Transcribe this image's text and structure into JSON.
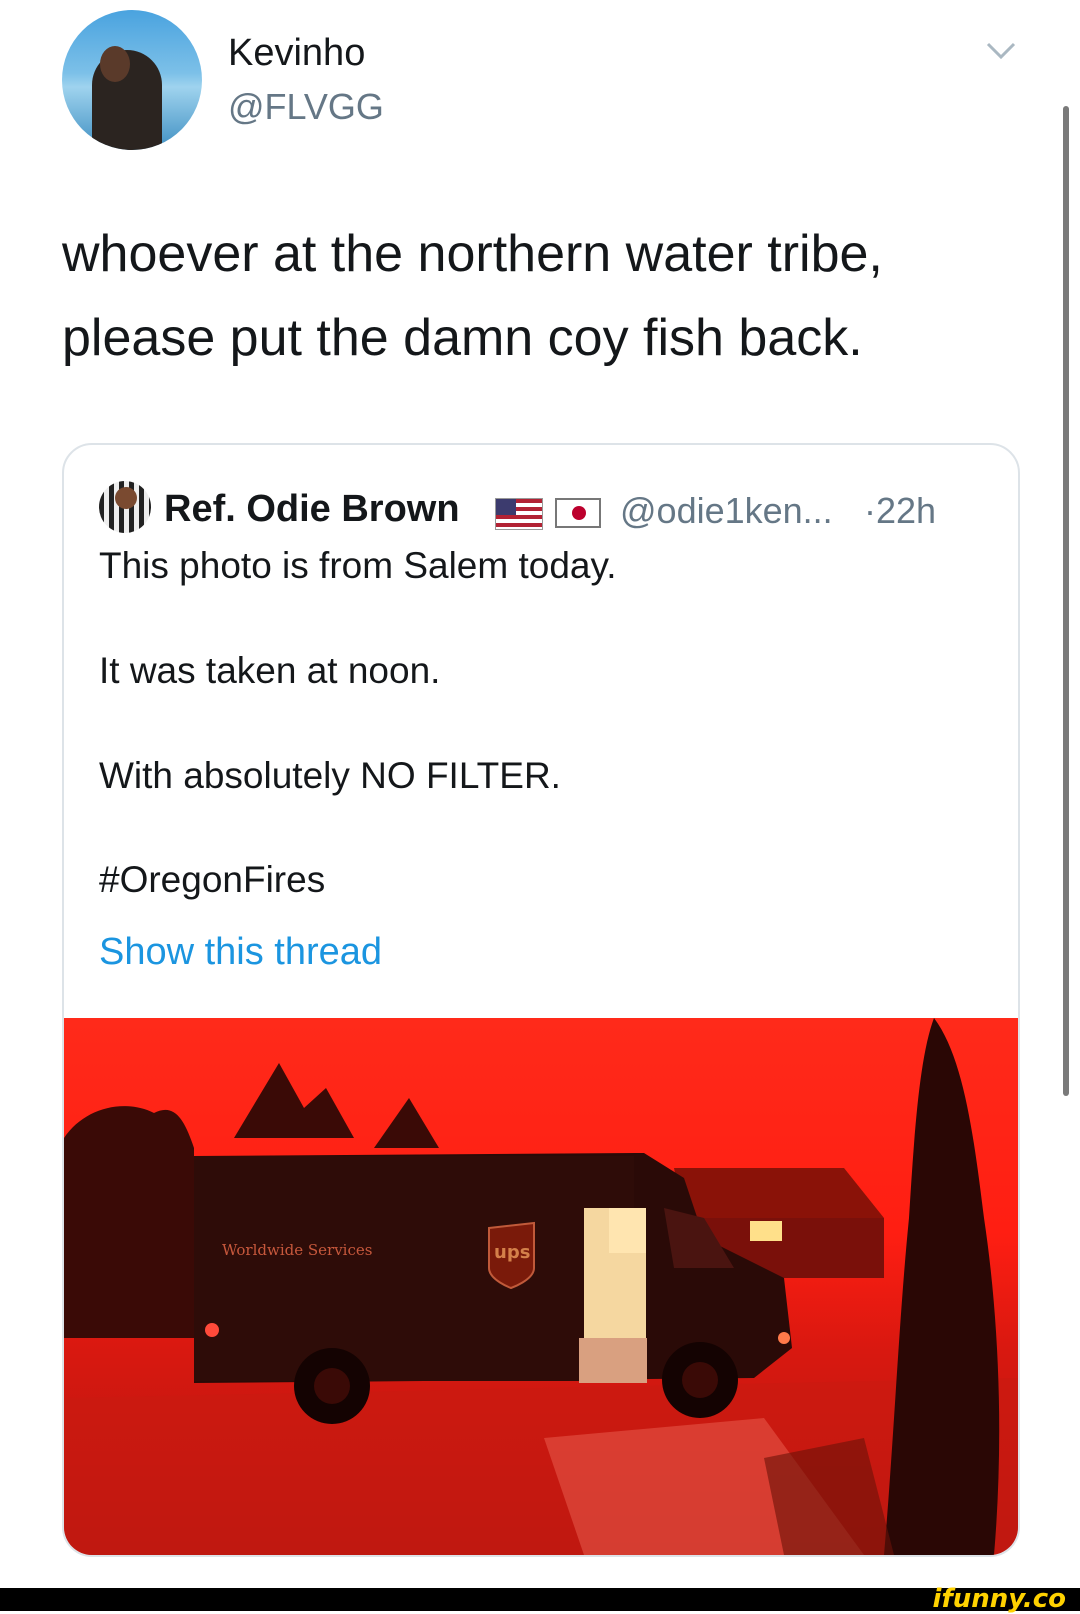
{
  "tweet": {
    "author_name": "Kevinho",
    "author_handle": "@FLVGG",
    "text_lines": [
      "whoever at the northern water tribe,",
      "please put the damn coy fish back."
    ]
  },
  "quoted": {
    "author_name": "Ref. Odie Brown",
    "handle": "@odie1ken...",
    "time": "·22h",
    "lines": [
      "This photo is from Salem today.",
      "It was taken at noon.",
      "With absolutely NO FILTER.",
      "#OregonFires"
    ],
    "show_thread": "Show this thread",
    "photo": {
      "truck_text": "Worldwide Services",
      "logo_text": "ups"
    }
  },
  "watermark": "ifunny.co",
  "icons": [
    "chevron-down-icon",
    "us-flag-icon",
    "japan-flag-icon"
  ],
  "colors": {
    "link": "#1b95e0",
    "secondary_text": "#657786",
    "photo_red": "#ff2a1a"
  }
}
